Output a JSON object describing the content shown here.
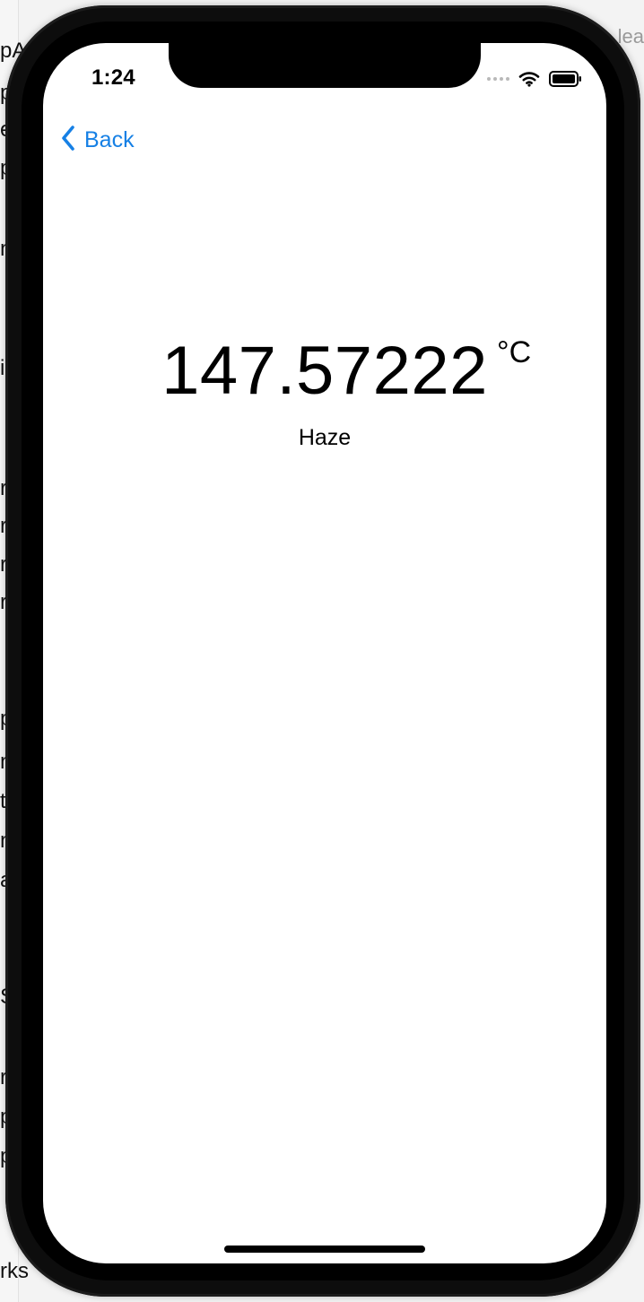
{
  "background": {
    "top_right_fragment": "lea",
    "left_fragments": [
      "pA",
      "p",
      "e",
      "p",
      "n",
      "i",
      "r",
      "r",
      "r",
      "r",
      "p",
      "n",
      "t",
      "n",
      "a",
      "S",
      "r",
      "p",
      "p"
    ],
    "bottom_left_fragment": "rks"
  },
  "status_bar": {
    "time": "1:24",
    "cellular_icon": "signal-dots-icon",
    "wifi_icon": "wifi-icon",
    "battery_icon": "battery-icon"
  },
  "navigation": {
    "back_label": "Back",
    "back_icon": "chevron-left-icon",
    "accent_color": "#1680e5"
  },
  "weather": {
    "temperature": "147.57222",
    "unit": "°C",
    "condition": "Haze"
  },
  "device": {
    "home_indicator": "home-indicator"
  }
}
